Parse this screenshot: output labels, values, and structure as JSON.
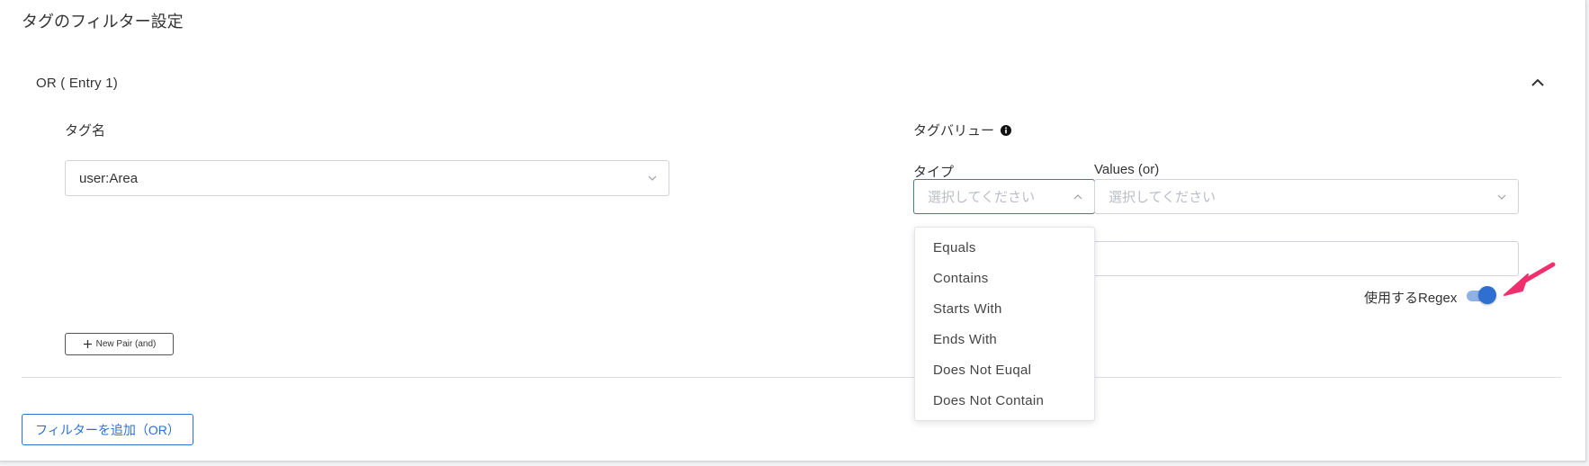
{
  "title": "タグのフィルター設定",
  "entry": {
    "title": "OR ( Entry 1)"
  },
  "tag_name": {
    "label": "タグ名",
    "value": "user:Area"
  },
  "tag_value": {
    "label": "タグバリュー",
    "type_label": "タイプ",
    "type_placeholder": "選択してください",
    "values_label": "Values (or)",
    "values_placeholder": "選択してください",
    "type_options": [
      "Equals",
      "Contains",
      "Starts With",
      "Ends With",
      "Does Not Euqal",
      "Does Not Contain"
    ],
    "regex_label": "使用するRegex",
    "regex_enabled": true
  },
  "new_pair_label": "New Pair (and)",
  "add_filter_label": "フィルターを追加（OR）",
  "colors": {
    "accent": "#2f6fd1",
    "arrow": "#f0306e"
  }
}
